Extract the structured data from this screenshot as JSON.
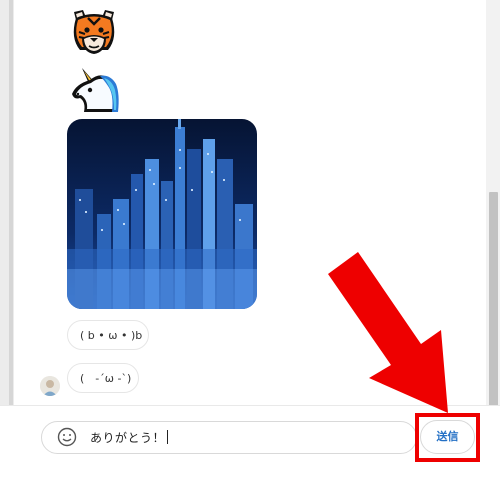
{
  "chat": {
    "messages": [
      {
        "type": "emoji",
        "icon": "tiger-face-icon"
      },
      {
        "type": "emoji",
        "icon": "unicorn-face-icon"
      },
      {
        "type": "image",
        "icon": "city-night-photo"
      },
      {
        "type": "text",
        "text": "( b • ω • )b"
      },
      {
        "type": "text",
        "text": "(　-´ω -`)"
      }
    ]
  },
  "composer": {
    "value": "ありがとう！",
    "emoji_icon": "smiley-icon",
    "send_label": "送信"
  },
  "annotation": {
    "arrow_color": "#ee0000",
    "box_color": "#ee0000"
  },
  "theme": {
    "send_text_color": "#2470c5"
  }
}
